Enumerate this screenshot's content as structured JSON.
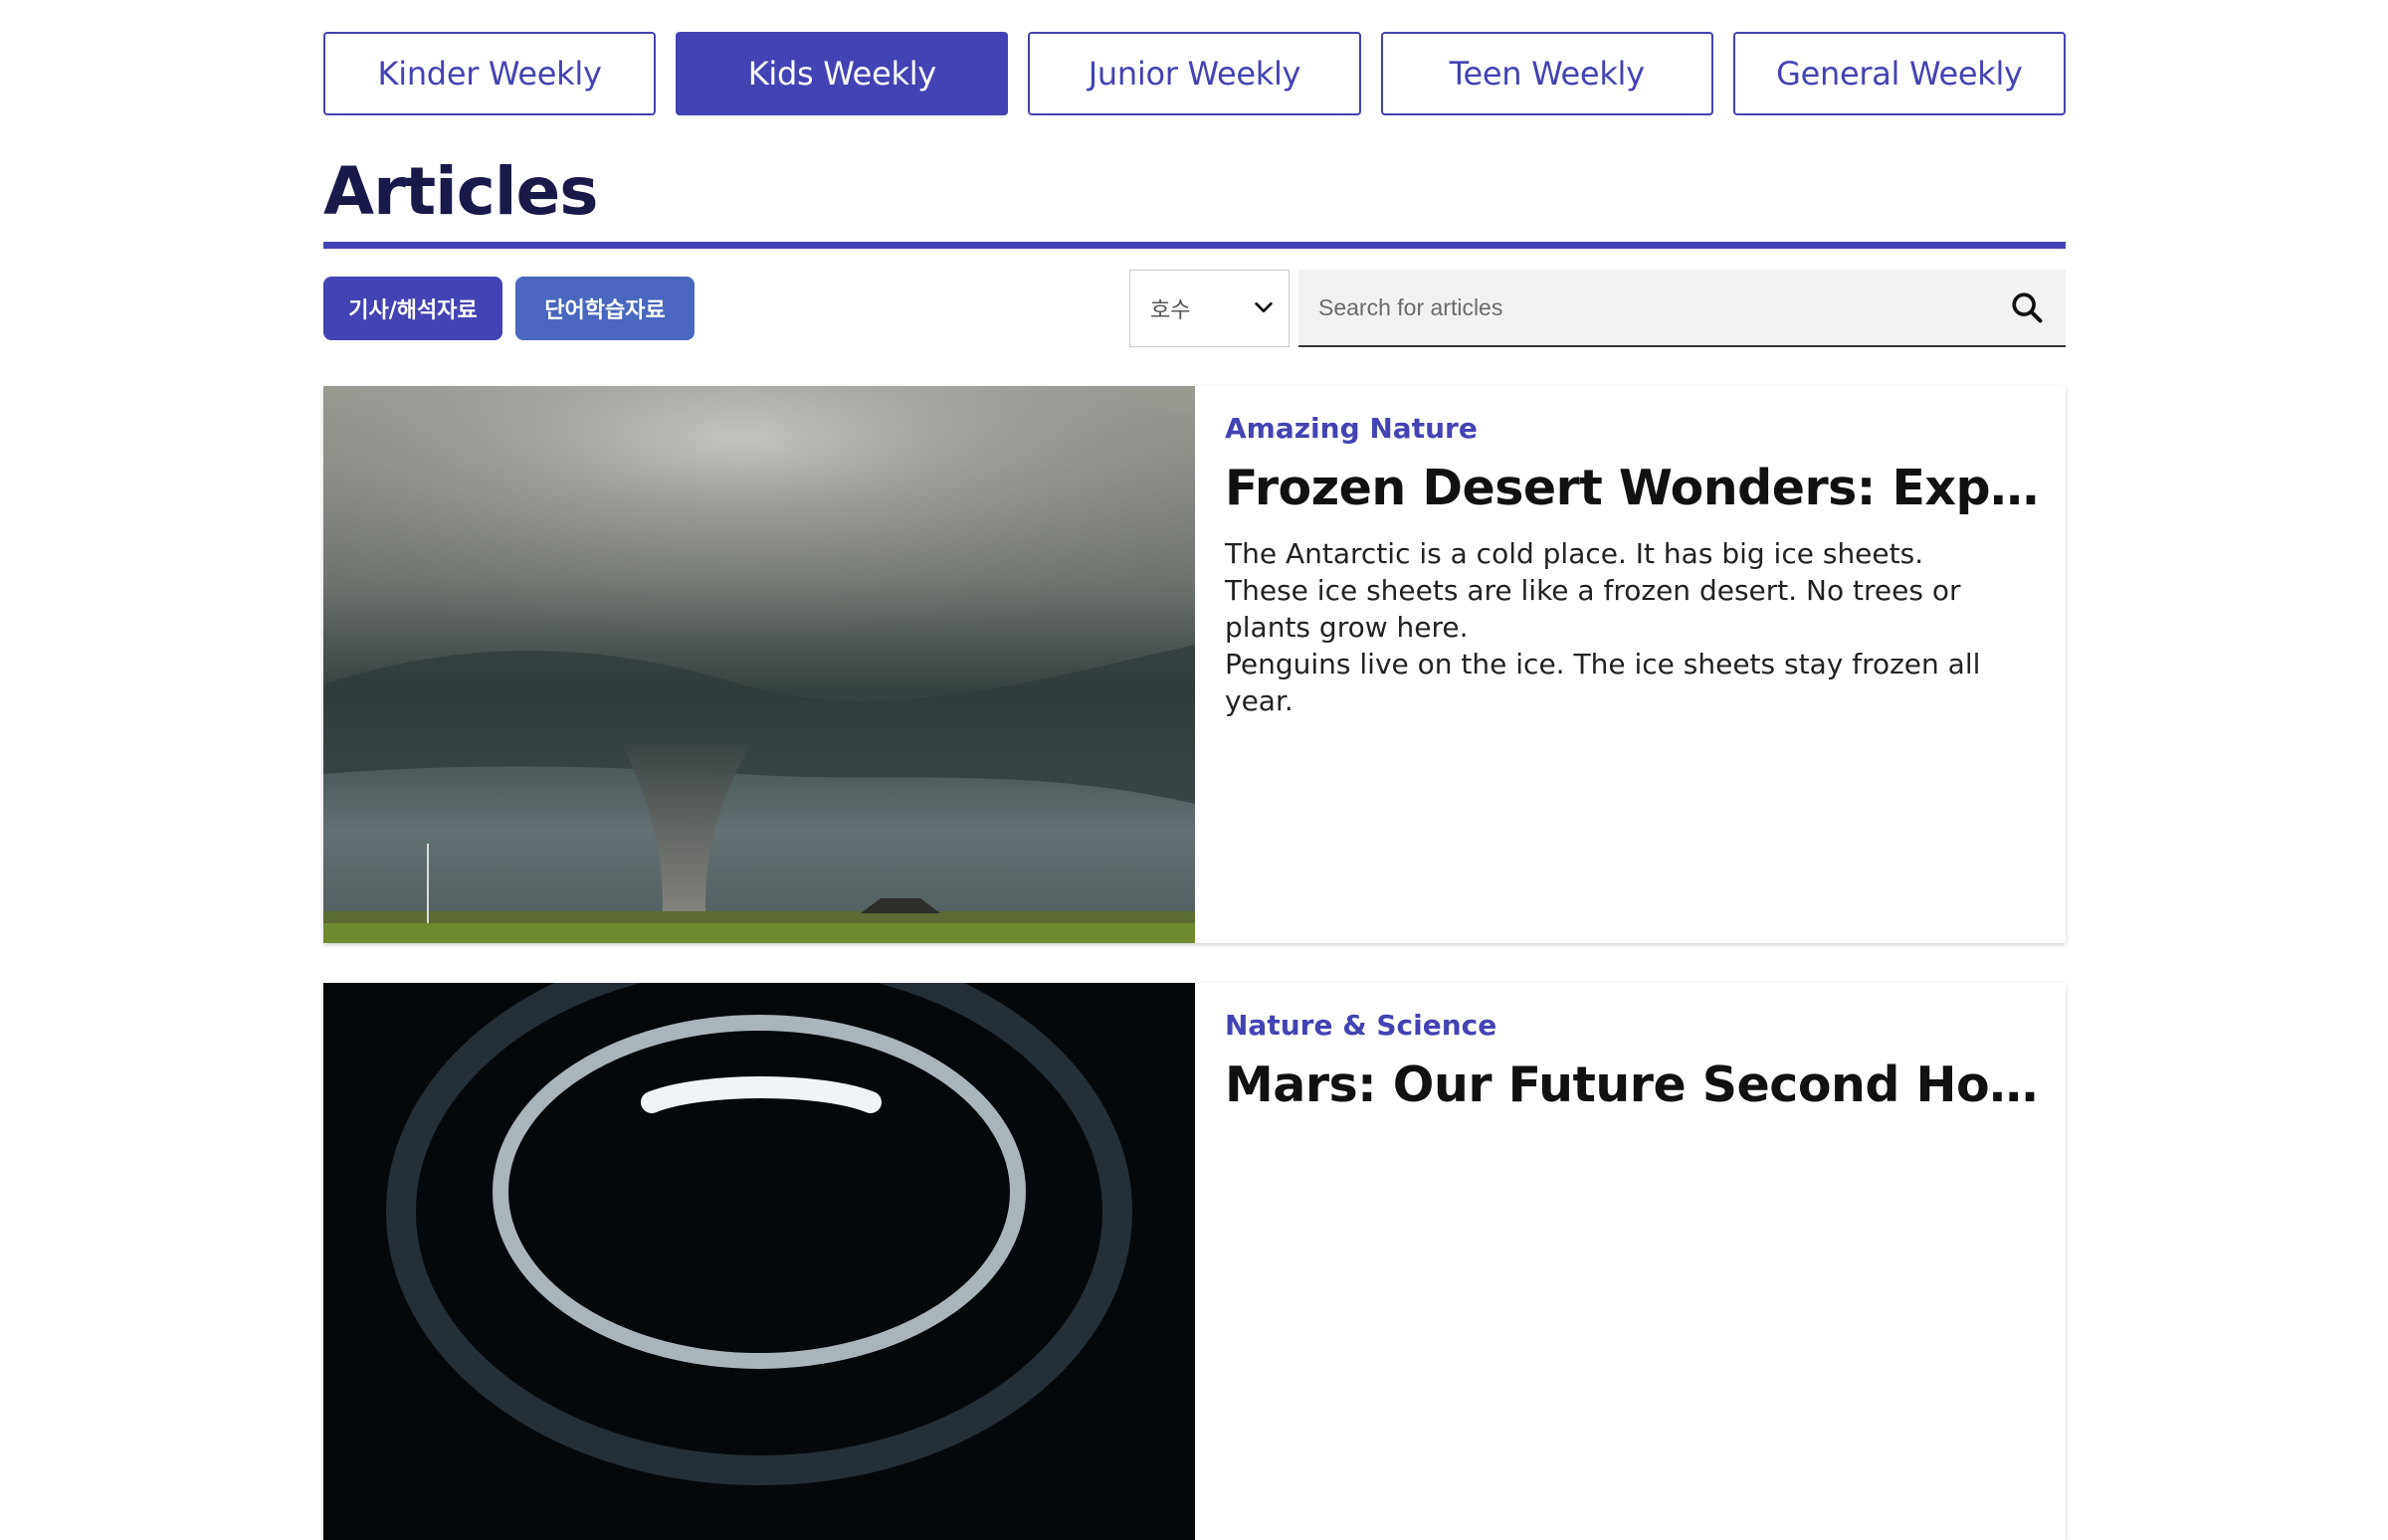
{
  "tabs": [
    {
      "label": "Kinder Weekly",
      "active": false
    },
    {
      "label": "Kids Weekly",
      "active": true
    },
    {
      "label": "Junior Weekly",
      "active": false
    },
    {
      "label": "Teen Weekly",
      "active": false
    },
    {
      "label": "General Weekly",
      "active": false
    }
  ],
  "page_title": "Articles",
  "toolbar": {
    "buttons": [
      {
        "label": "기사/해석자료"
      },
      {
        "label": "단어학습자료"
      }
    ],
    "issue_select": {
      "value": "호수",
      "icon": "chevron-down-icon"
    },
    "search": {
      "placeholder": "Search for articles",
      "icon": "search-icon"
    }
  },
  "articles": [
    {
      "category": "Amazing Nature",
      "title": "Frozen Desert Wonders: Exploring...",
      "excerpt": [
        "The Antarctic is a cold place. It has big ice sheets.",
        "These ice sheets are like a frozen desert. No trees or plants grow here.",
        "Penguins live on the ice. The ice sheets stay frozen all year."
      ]
    },
    {
      "category": "Nature & Science",
      "title": "Mars: Our Future Second Home?",
      "excerpt": []
    }
  ],
  "colors": {
    "accent": "#4343b3",
    "accent_secondary": "#4a66bf",
    "title": "#1a1a4a"
  }
}
